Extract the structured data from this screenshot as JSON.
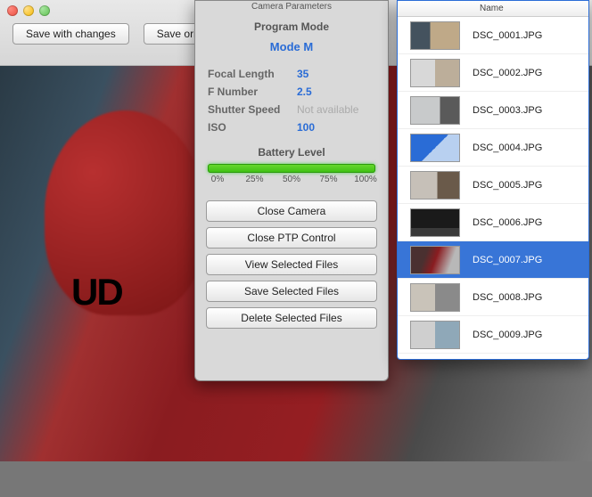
{
  "header": {
    "save_with_changes": "Save with changes",
    "save_original": "Save origina"
  },
  "camera": {
    "panel_title": "Camera Parameters",
    "program_mode_label": "Program Mode",
    "program_mode_value": "Mode M",
    "params": {
      "focal_length_label": "Focal Length",
      "focal_length_value": "35",
      "f_number_label": "F Number",
      "f_number_value": "2.5",
      "shutter_label": "Shutter Speed",
      "shutter_value": "Not available",
      "iso_label": "ISO",
      "iso_value": "100"
    },
    "battery_label": "Battery Level",
    "battery_ticks": [
      "0%",
      "25%",
      "50%",
      "75%",
      "100%"
    ],
    "buttons": {
      "close_camera": "Close Camera",
      "close_ptp": "Close PTP Control",
      "view_selected": "View Selected Files",
      "save_selected": "Save Selected Files",
      "delete_selected": "Delete Selected Files"
    }
  },
  "filelist": {
    "col_name": "Name",
    "rows": [
      {
        "name": "DSC_0001.JPG"
      },
      {
        "name": "DSC_0002.JPG"
      },
      {
        "name": "DSC_0003.JPG"
      },
      {
        "name": "DSC_0004.JPG"
      },
      {
        "name": "DSC_0005.JPG"
      },
      {
        "name": "DSC_0006.JPG"
      },
      {
        "name": "DSC_0007.JPG"
      },
      {
        "name": "DSC_0008.JPG"
      },
      {
        "name": "DSC_0009.JPG"
      }
    ],
    "selected_index": 6
  }
}
